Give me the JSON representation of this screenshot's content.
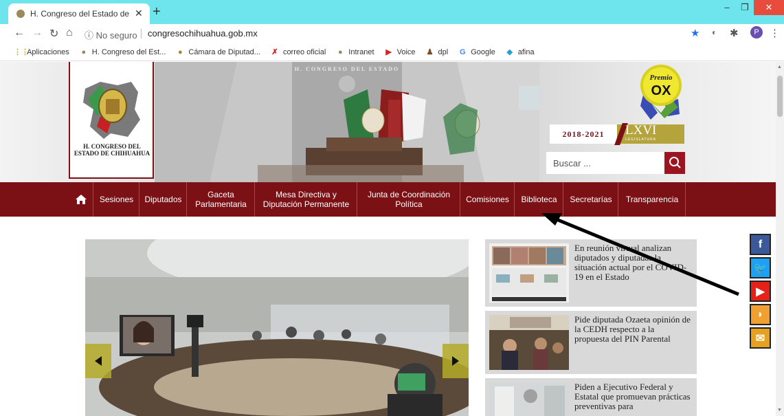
{
  "browser": {
    "tab_title": "H. Congreso del Estado de Chihua",
    "new_tab": "+",
    "tab_close": "✕",
    "url_info": "ⓘ No seguro",
    "url": "congresochihuahua.gob.mx",
    "profile_initial": "P",
    "bookmarks": [
      {
        "label": "Aplicaciones",
        "icon": "apps-icon"
      },
      {
        "label": "H. Congreso del Est...",
        "icon": "congreso-icon"
      },
      {
        "label": "Cámara de Diputad...",
        "icon": "camara-icon"
      },
      {
        "label": "correo oficial",
        "icon": "correo-icon"
      },
      {
        "label": "Intranet",
        "icon": "congreso-icon"
      },
      {
        "label": "Voice",
        "icon": "youtube-icon"
      },
      {
        "label": "dpl",
        "icon": "dpl-icon"
      },
      {
        "label": "Google",
        "icon": "google-icon"
      },
      {
        "label": "afina",
        "icon": "afina-icon"
      }
    ]
  },
  "header": {
    "logo_name": "H. CONGRESO DEL ESTADO DE CHIHUAHUA",
    "hall_sign": "H. CONGRESO DEL ESTADO",
    "premio_text": "Premio",
    "premio_ox": "OX",
    "years": "2018-2021",
    "legislatura": "LXVI",
    "legislatura_sub": "LEGISLATURA",
    "search_placeholder": "Buscar ..."
  },
  "nav": {
    "items": [
      {
        "label": "Sesiones"
      },
      {
        "label": "Diputados"
      },
      {
        "label": "Gaceta Parlamentaria"
      },
      {
        "label": "Mesa Directiva y Diputación Permanente"
      },
      {
        "label": "Junta de Coordinación Política"
      },
      {
        "label": "Comisiones"
      },
      {
        "label": "Biblioteca"
      },
      {
        "label": "Secretarías"
      },
      {
        "label": "Transparencia"
      }
    ]
  },
  "news": [
    {
      "text": "En reunión virtual analizan diputados y diputadas la situación actual por el COVID-19 en el Estado"
    },
    {
      "text": "Pide diputada Ozaeta opinión de la CEDH respecto a la propuesta del PIN Parental"
    },
    {
      "text": "Piden a Ejecutivo Federal y Estatal que promuevan prácticas preventivas para"
    }
  ],
  "social": [
    {
      "name": "facebook",
      "glyph": "f",
      "color": "#3b5998"
    },
    {
      "name": "twitter",
      "glyph": "🐦",
      "color": "#1da1f2"
    },
    {
      "name": "youtube",
      "glyph": "▶",
      "color": "#e62117"
    },
    {
      "name": "rss",
      "glyph": "◗",
      "color": "#f0a030"
    },
    {
      "name": "email",
      "glyph": "✉",
      "color": "#e8a020"
    }
  ]
}
